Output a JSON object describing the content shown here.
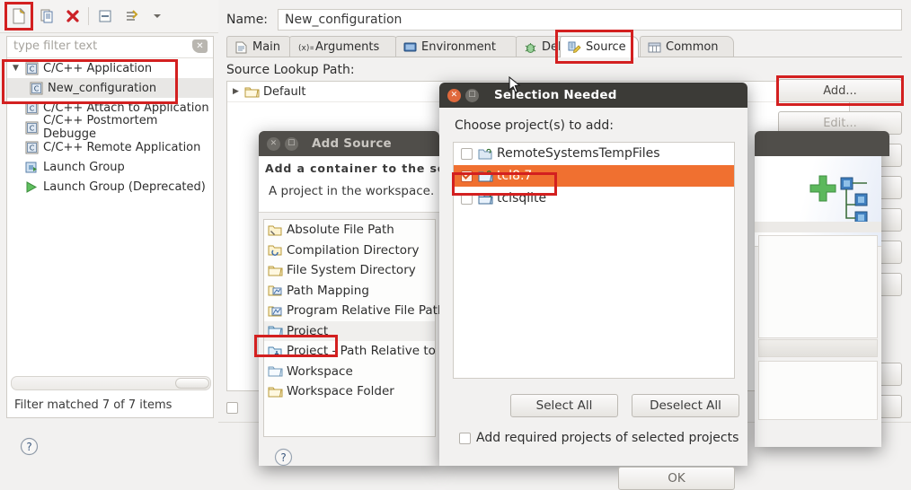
{
  "app": {
    "left_panel": {
      "toolbar_icons": [
        "new-launch-configuration-icon",
        "duplicate-icon",
        "delete-icon",
        "collapse-all-icon",
        "filter-icon",
        "view-menu-icon"
      ],
      "filter": {
        "placeholder": "type filter text",
        "value": ""
      },
      "tree": [
        {
          "label": "C/C++ Application",
          "icon": "c-app-icon",
          "expanded": true,
          "indent": 0,
          "selected": false
        },
        {
          "label": "New_configuration",
          "icon": "c-app-icon",
          "expanded": false,
          "indent": 1,
          "selected": true
        },
        {
          "label": "C/C++ Attach to Application",
          "icon": "c-app-icon",
          "expanded": false,
          "indent": 0,
          "selected": false
        },
        {
          "label": "C/C++ Postmortem Debugge",
          "icon": "c-app-icon",
          "expanded": false,
          "indent": 0,
          "selected": false
        },
        {
          "label": "C/C++ Remote Application",
          "icon": "c-app-icon",
          "expanded": false,
          "indent": 0,
          "selected": false
        },
        {
          "label": "Launch Group",
          "icon": "launch-group-icon",
          "expanded": false,
          "indent": 0,
          "selected": false
        },
        {
          "label": "Launch Group (Deprecated)",
          "icon": "launch-group-deprecated-icon",
          "expanded": false,
          "indent": 0,
          "selected": false
        }
      ],
      "status": "Filter matched 7 of 7 items"
    },
    "config": {
      "name_label": "Name:",
      "name_value": "New_configuration",
      "tabs": [
        {
          "label": "Main",
          "icon": "main-tab-icon",
          "active": false
        },
        {
          "label": "Arguments",
          "icon": "arguments-tab-icon",
          "active": false
        },
        {
          "label": "Environment",
          "icon": "environment-tab-icon",
          "active": false
        },
        {
          "label": "Debugger",
          "icon": "debugger-tab-icon",
          "active": false
        },
        {
          "label": "Source",
          "icon": "source-tab-icon",
          "active": true
        },
        {
          "label": "Common",
          "icon": "common-tab-icon",
          "active": false
        }
      ],
      "lookup_label": "Source Lookup Path:",
      "lookup_items": [
        {
          "label": "Default",
          "icon": "folder-icon",
          "expanded": false
        }
      ],
      "buttons": [
        {
          "id": "add",
          "label": "Add...",
          "enabled": true
        },
        {
          "id": "edit",
          "label": "Edit...",
          "enabled": false
        }
      ]
    },
    "add_source_dialog": {
      "title": "Add Source",
      "hint": "Add a container to the source",
      "description": "A project in the workspace.",
      "items": [
        {
          "label": "Absolute File Path",
          "icon": "absolute-file-path-icon",
          "selected": false
        },
        {
          "label": "Compilation Directory",
          "icon": "compilation-directory-icon",
          "selected": false
        },
        {
          "label": "File System Directory",
          "icon": "file-system-directory-icon",
          "selected": false
        },
        {
          "label": "Path Mapping",
          "icon": "path-mapping-icon",
          "selected": false
        },
        {
          "label": "Program Relative File Path",
          "icon": "program-relative-file-path-icon",
          "selected": false
        },
        {
          "label": "Project",
          "icon": "project-icon",
          "selected": true
        },
        {
          "label": "Project - Path Relative to So",
          "icon": "project-path-relative-icon",
          "selected": false
        },
        {
          "label": "Workspace",
          "icon": "workspace-icon",
          "selected": false
        },
        {
          "label": "Workspace Folder",
          "icon": "workspace-folder-icon",
          "selected": false
        }
      ],
      "help_icon": "help-icon"
    },
    "selection_dialog": {
      "title": "Selection Needed",
      "prompt": "Choose project(s) to add:",
      "projects": [
        {
          "label": "RemoteSystemsTempFiles",
          "checked": false,
          "selected": false,
          "icon": "project-closed-icon"
        },
        {
          "label": "tcl8.7",
          "checked": true,
          "selected": true,
          "icon": "project-open-icon"
        },
        {
          "label": "tclsqlite",
          "checked": false,
          "selected": false,
          "icon": "project-open-icon"
        }
      ],
      "select_all_label": "Select All",
      "deselect_all_label": "Deselect All",
      "required_label": "Add required projects of selected projects",
      "required_checked": false,
      "ok_label": "OK"
    },
    "colors": {
      "selection_orange": "#f07030",
      "annotation_red": "#d32020",
      "titlebar_dark": "#3c3b37",
      "panel_bg": "#f2f1f0"
    }
  }
}
